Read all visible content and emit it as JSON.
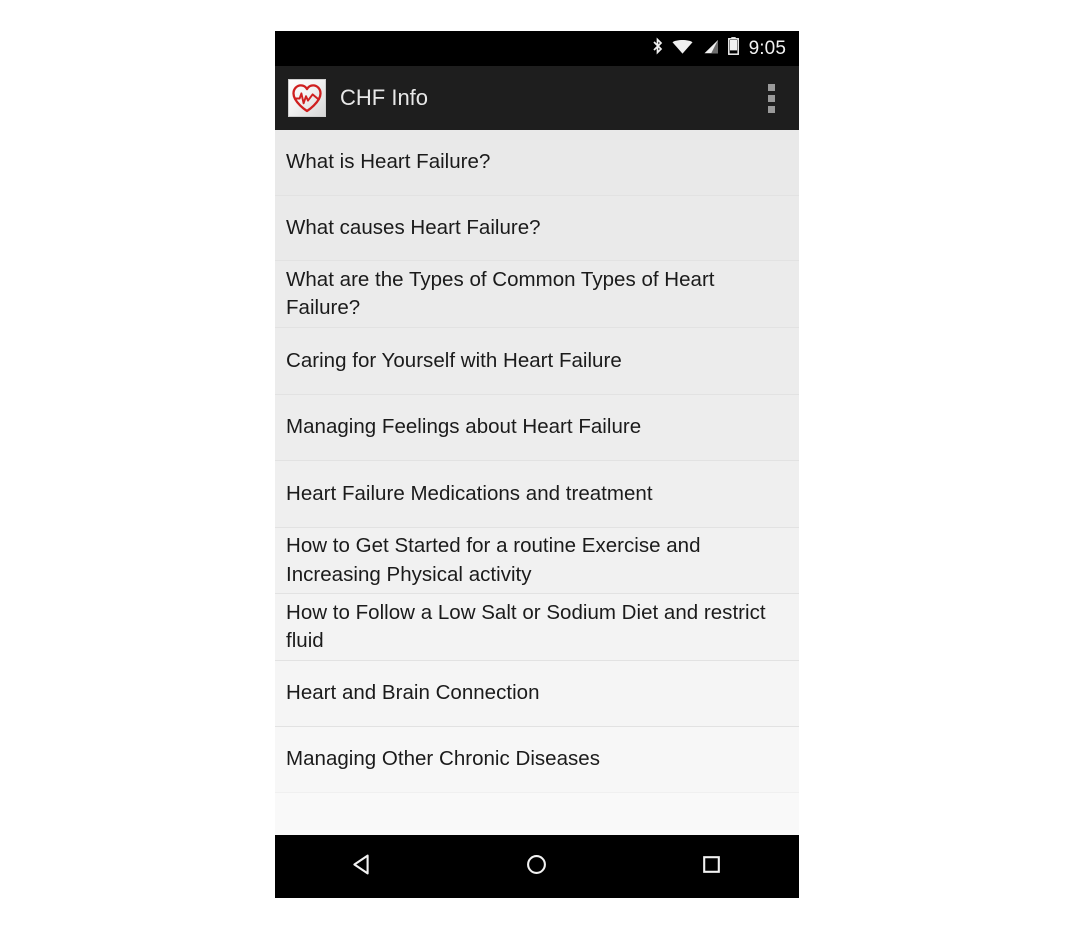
{
  "status_bar": {
    "clock": "9:05",
    "icons": [
      {
        "name": "bluetooth-icon"
      },
      {
        "name": "wifi-icon"
      },
      {
        "name": "cellular-signal-icon"
      },
      {
        "name": "battery-icon"
      }
    ]
  },
  "action_bar": {
    "title": "CHF Info",
    "app_icon_name": "heart-ecg-app-icon",
    "overflow_menu_name": "overflow-menu-button"
  },
  "list": {
    "items": [
      {
        "label": "What is Heart Failure?"
      },
      {
        "label": "What causes Heart Failure?"
      },
      {
        "label": "What are the Types of Common Types of Heart Failure?"
      },
      {
        "label": "Caring for Yourself with Heart Failure"
      },
      {
        "label": "Managing Feelings about Heart Failure"
      },
      {
        "label": "Heart Failure Medications and treatment"
      },
      {
        "label": "How to Get Started for a routine Exercise and Increasing Physical activity"
      },
      {
        "label": "How to Follow a Low Salt or Sodium Diet and restrict fluid"
      },
      {
        "label": "Heart and Brain Connection"
      },
      {
        "label": "Managing Other Chronic Diseases"
      }
    ]
  },
  "nav_bar": {
    "buttons": [
      {
        "name": "back-button"
      },
      {
        "name": "home-button"
      },
      {
        "name": "recents-button"
      }
    ]
  },
  "colors": {
    "status_bar_bg": "#000000",
    "action_bar_bg": "#1e1e1e",
    "list_bg": "#eaeaea",
    "divider": "#e2e2e2",
    "text_primary": "#1b1b1b",
    "title_text": "#e8e8e8",
    "accent_red": "#d32020",
    "nav_bar_bg": "#000000"
  }
}
